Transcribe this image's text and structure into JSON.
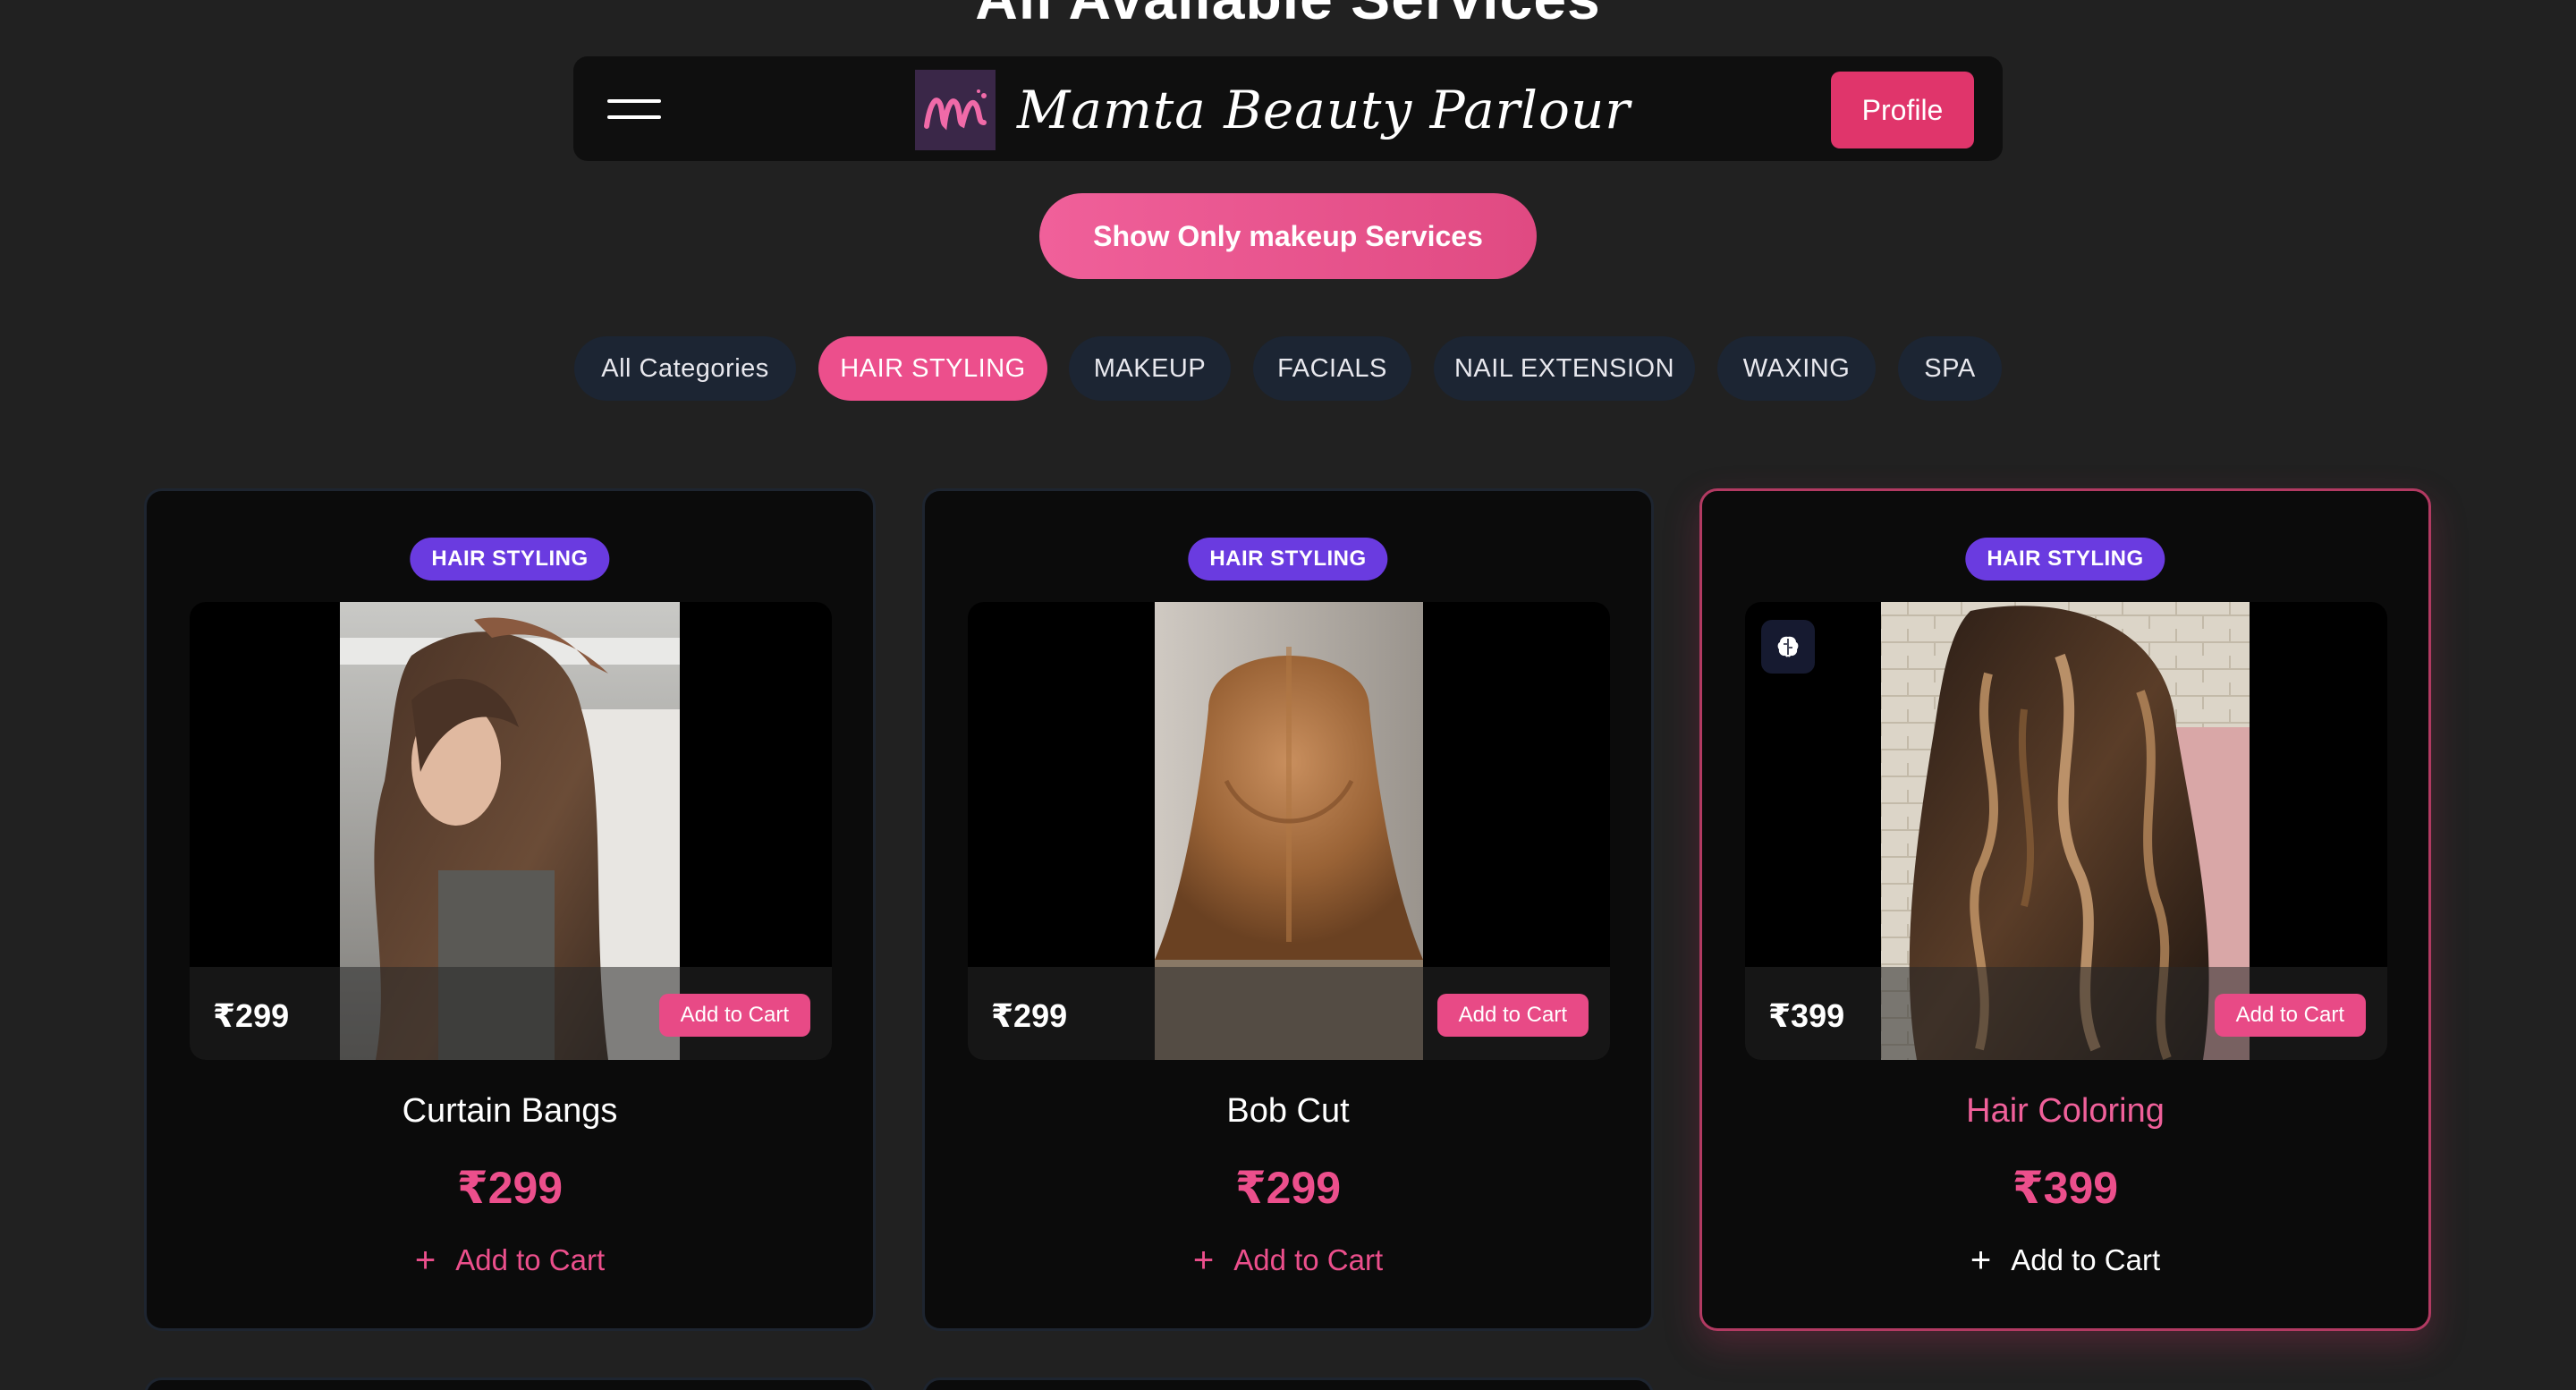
{
  "page_title": "All Available Services",
  "navbar": {
    "brand": "Mamta Beauty Parlour",
    "profile_label": "Profile"
  },
  "toggle_label": "Show Only makeup Services",
  "categories": [
    {
      "label": "All Categories",
      "active": false
    },
    {
      "label": "HAIR STYLING",
      "active": true
    },
    {
      "label": "MAKEUP",
      "active": false
    },
    {
      "label": "FACIALS",
      "active": false
    },
    {
      "label": "NAIL EXTENSION",
      "active": false
    },
    {
      "label": "WAXING",
      "active": false
    },
    {
      "label": "SPA",
      "active": false
    }
  ],
  "cards": [
    {
      "category": "HAIR STYLING",
      "name": "Curtain Bangs",
      "overlay_price": "₹299",
      "price": "₹299",
      "overlay_cart": "Add to Cart",
      "cart_label": "Add to Cart",
      "highlighted": false
    },
    {
      "category": "HAIR STYLING",
      "name": "Bob Cut",
      "overlay_price": "₹299",
      "price": "₹299",
      "overlay_cart": "Add to Cart",
      "cart_label": "Add to Cart",
      "highlighted": false
    },
    {
      "category": "HAIR STYLING",
      "name": "Hair Coloring",
      "overlay_price": "₹399",
      "price": "₹399",
      "overlay_cart": "Add to Cart",
      "cart_label": "Add to Cart",
      "highlighted": true
    }
  ],
  "colors": {
    "background": "#212121",
    "accent": "#ec4f8c",
    "badge": "#6a3be0",
    "chip": "#1c2533"
  }
}
